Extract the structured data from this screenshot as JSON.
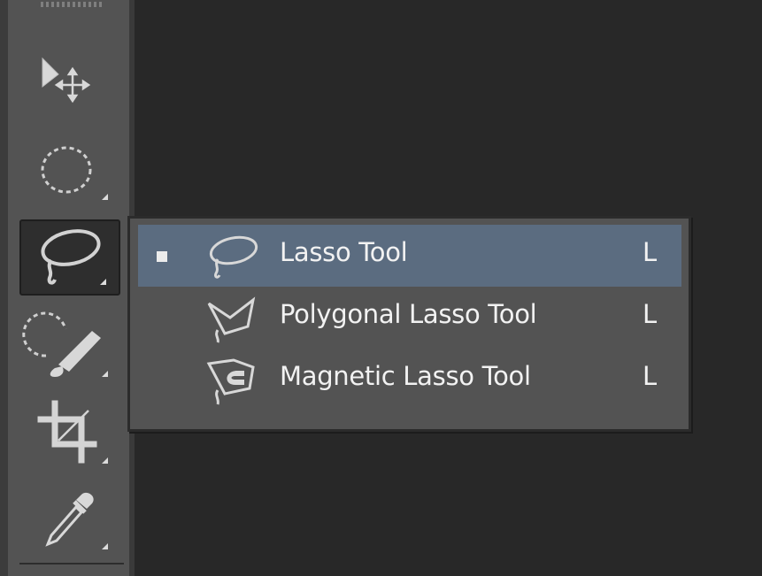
{
  "toolbar": {
    "tools": [
      {
        "name": "move-tool",
        "icon": "move-icon",
        "has_flyout": false
      },
      {
        "name": "marquee-tool",
        "icon": "elliptical-marquee-icon",
        "has_flyout": true
      },
      {
        "name": "lasso-tool",
        "icon": "lasso-icon",
        "has_flyout": true,
        "active": true
      },
      {
        "name": "quick-selection-tool",
        "icon": "quick-selection-brush-icon",
        "has_flyout": true
      },
      {
        "name": "crop-tool",
        "icon": "crop-icon",
        "has_flyout": true
      },
      {
        "name": "eyedropper-tool",
        "icon": "eyedropper-icon",
        "has_flyout": true
      }
    ]
  },
  "flyout_menu": {
    "items": [
      {
        "label": "Lasso Tool",
        "shortcut": "L",
        "icon": "lasso-icon",
        "checked": true
      },
      {
        "label": "Polygonal Lasso Tool",
        "shortcut": "L",
        "icon": "polygonal-lasso-icon",
        "checked": false
      },
      {
        "label": "Magnetic Lasso Tool",
        "shortcut": "L",
        "icon": "magnetic-lasso-icon",
        "checked": false
      }
    ]
  },
  "colors": {
    "toolbar_bg": "#535353",
    "canvas_bg": "#282828",
    "menu_bg": "#535353",
    "selected_item_bg": "#5b6c80",
    "text": "#f2f2f2"
  }
}
